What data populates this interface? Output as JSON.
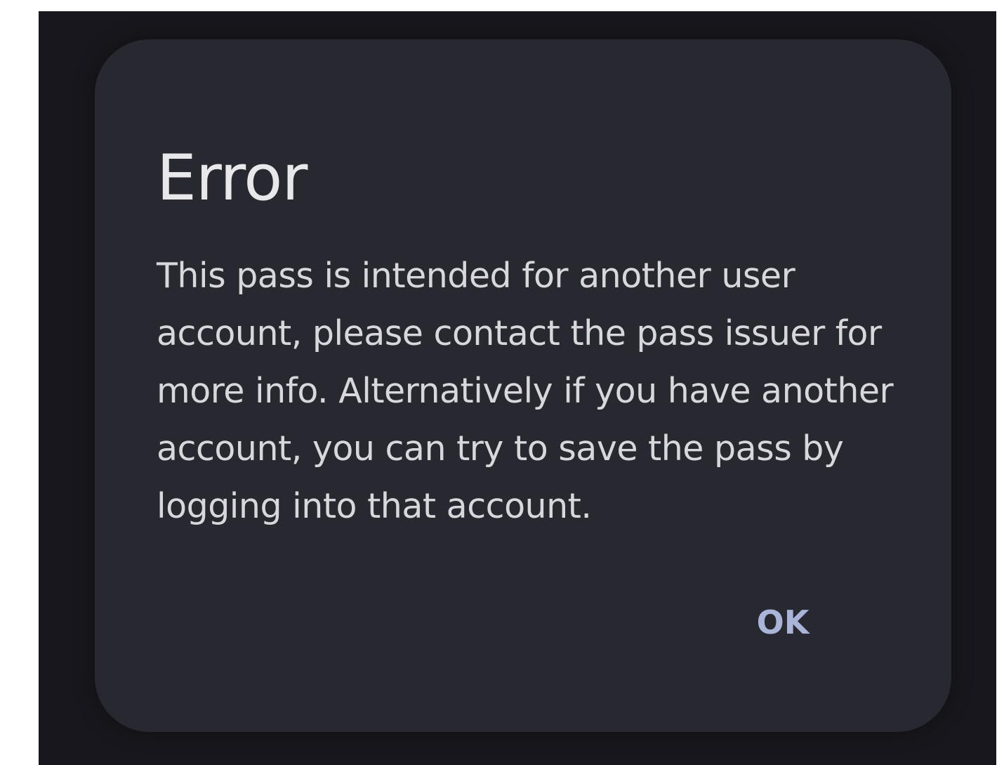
{
  "dialog": {
    "title": "Error",
    "message": "This pass is intended for another user account, please contact the pass issuer for more info. Alternatively if you have another account, you can try to save the pass by logging into that account.",
    "ok_label": "OK"
  },
  "colors": {
    "screen_background": "#17171d",
    "dialog_background": "#272830",
    "title_text": "#e8e8ea",
    "message_text": "#d8d8dc",
    "button_accent": "#aab4d8"
  }
}
